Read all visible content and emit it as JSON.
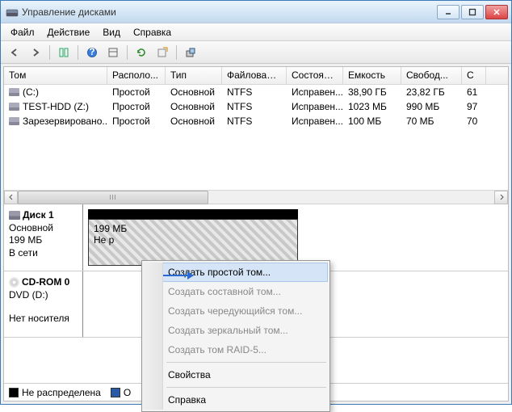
{
  "window": {
    "title": "Управление дисками"
  },
  "menubar": [
    "Файл",
    "Действие",
    "Вид",
    "Справка"
  ],
  "columns": [
    "Том",
    "Располо...",
    "Тип",
    "Файловая с...",
    "Состояние",
    "Емкость",
    "Свобод...",
    "С"
  ],
  "volumes": [
    {
      "name": "(C:)",
      "layout": "Простой",
      "type": "Основной",
      "fs": "NTFS",
      "status": "Исправен...",
      "capacity": "38,90 ГБ",
      "free": "23,82 ГБ",
      "pct": "61"
    },
    {
      "name": "TEST-HDD (Z:)",
      "layout": "Простой",
      "type": "Основной",
      "fs": "NTFS",
      "status": "Исправен...",
      "capacity": "1023 МБ",
      "free": "990 МБ",
      "pct": "97"
    },
    {
      "name": "Зарезервировано...",
      "layout": "Простой",
      "type": "Основной",
      "fs": "NTFS",
      "status": "Исправен...",
      "capacity": "100 МБ",
      "free": "70 МБ",
      "pct": "70"
    }
  ],
  "disks": [
    {
      "title": "Диск 1",
      "type": "Основной",
      "size": "199 МБ",
      "status": "В сети",
      "partition": {
        "size": "199 МБ",
        "status": "Не р"
      }
    },
    {
      "title": "CD-ROM 0",
      "type": "DVD (D:)",
      "size": "",
      "status": "Нет носителя",
      "partition": null
    }
  ],
  "legend": {
    "unallocated": "Не распределена",
    "primary": "О"
  },
  "context_menu": {
    "items": [
      {
        "label": "Создать простой том...",
        "enabled": true,
        "hover": true
      },
      {
        "label": "Создать составной том...",
        "enabled": false
      },
      {
        "label": "Создать чередующийся том...",
        "enabled": false
      },
      {
        "label": "Создать зеркальный том...",
        "enabled": false
      },
      {
        "label": "Создать том RAID-5...",
        "enabled": false
      }
    ],
    "sep_items": [
      {
        "label": "Свойства",
        "enabled": true
      },
      {
        "label": "Справка",
        "enabled": true
      }
    ]
  }
}
